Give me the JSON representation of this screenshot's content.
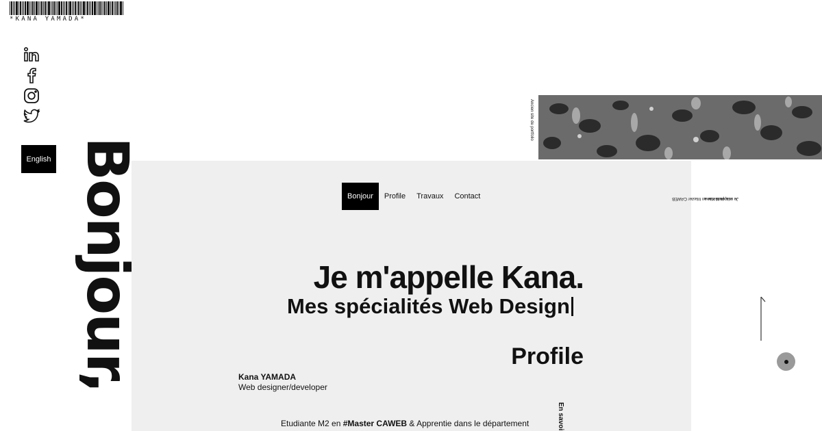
{
  "logo": {
    "text": "*KANA YAMADA*",
    "icon": "barcode-logo"
  },
  "social": [
    {
      "name": "LinkedIn",
      "icon": "linkedin-icon"
    },
    {
      "name": "Facebook",
      "icon": "facebook-icon"
    },
    {
      "name": "Instagram",
      "icon": "instagram-icon"
    },
    {
      "name": "Twitter",
      "icon": "twitter-icon"
    }
  ],
  "language_button": "English",
  "big_greeting": "Bonjour,",
  "nav": {
    "items": [
      "Bonjour",
      "Profile",
      "Travaux",
      "Contact"
    ],
    "active": "Bonjour"
  },
  "hero": {
    "title": "Je m'appelle Kana.",
    "subtitle": "Mes spécialités Web Design"
  },
  "profile": {
    "heading": "Profile",
    "name": "Kana YAMADA",
    "role": "Web designer/developer",
    "desc_part1": "Etudiante M2 en ",
    "desc_bold1": "#Master CAWEB",
    "desc_part2": " & Apprentie dans le département",
    "more_link": "En savoir"
  },
  "sidebar_right": {
    "old_site_link": "Ancien site de portfolio",
    "intro_line1": "Je m'appelle Kana.",
    "intro_line2": "Je suis étudiante en Master CAWEB"
  },
  "colors": {
    "panel": "#efefef",
    "black": "#000000",
    "dot": "#9a9a9a"
  }
}
